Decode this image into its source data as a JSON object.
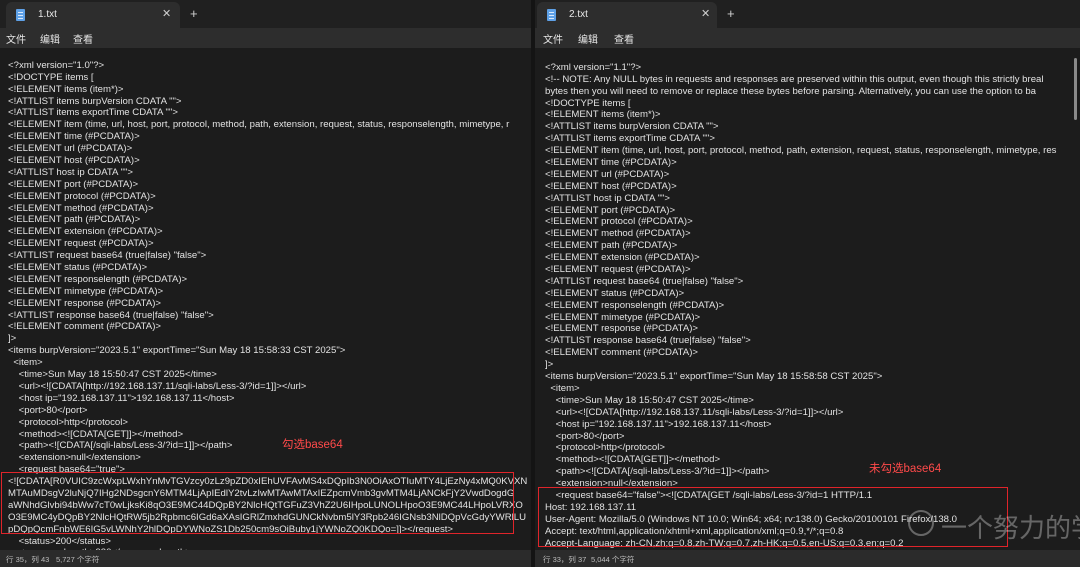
{
  "left": {
    "tab_title": "1.txt",
    "tab_close": "✕",
    "new_tab": "+",
    "menu": [
      "文件",
      "编辑",
      "查看"
    ],
    "lines": [
      "",
      "<?xml version=\"1.0\"?>",
      "<!DOCTYPE items [",
      "<!ELEMENT items (item*)>",
      "<!ATTLIST items burpVersion CDATA \"\">",
      "<!ATTLIST items exportTime CDATA \"\">",
      "<!ELEMENT item (time, url, host, port, protocol, method, path, extension, request, status, responselength, mimetype, r",
      "<!ELEMENT time (#PCDATA)>",
      "<!ELEMENT url (#PCDATA)>",
      "<!ELEMENT host (#PCDATA)>",
      "<!ATTLIST host ip CDATA \"\">",
      "<!ELEMENT port (#PCDATA)>",
      "<!ELEMENT protocol (#PCDATA)>",
      "<!ELEMENT method (#PCDATA)>",
      "<!ELEMENT path (#PCDATA)>",
      "<!ELEMENT extension (#PCDATA)>",
      "<!ELEMENT request (#PCDATA)>",
      "<!ATTLIST request base64 (true|false) \"false\">",
      "<!ELEMENT status (#PCDATA)>",
      "<!ELEMENT responselength (#PCDATA)>",
      "<!ELEMENT mimetype (#PCDATA)>",
      "<!ELEMENT response (#PCDATA)>",
      "<!ATTLIST response base64 (true|false) \"false\">",
      "<!ELEMENT comment (#PCDATA)>",
      "]>",
      "<items burpVersion=\"2023.5.1\" exportTime=\"Sun May 18 15:58:33 CST 2025\">",
      "  <item>",
      "    <time>Sun May 18 15:50:47 CST 2025</time>",
      "    <url><![CDATA[http://192.168.137.11/sqli-labs/Less-3/?id=1]]></url>",
      "    <host ip=\"192.168.137.11\">192.168.137.11</host>",
      "    <port>80</port>",
      "    <protocol>http</protocol>",
      "    <method><![CDATA[GET]]></method>",
      "    <path><![CDATA[/sqli-labs/Less-3/?id=1]]></path>",
      "    <extension>null</extension>",
      "    <request base64=\"true\">",
      "<![CDATA[R0VUIC9zcWxpLWxhYnMvTGVzcy0zLz9pZD0xIEhUVFAvMS4xDQpIb3N0OiAxOTIuMTY4LjEzNy4xMQ0KVXN",
      "MTAuMDsgV2luNjQ7IHg2NDsgcnY6MTM4LjApIEdlY2tvLzIwMTAwMTAxIEZpcmVmb3gvMTM4LjANCkFjY2VwdDogdG",
      "aWNhdGlvbi94bWw7cT0wLjksKi8qO3E9MC44DQpBY2NlcHQtTGFuZ3VhZ2U6IHpoLUNOLHpoO3E9MC44LHpoLVRXO",
      "O3E9MC4yDQpBY2NlcHQtRW5jb2Rpbmc6IGd6aXAsIGRlZmxhdGUNCkNvbm5lY3Rpb246IGNsb3NlDQpVcGdyYWRlLU",
      "pDQpQcmFnbWE6IG5vLWNhY2hlDQpDYWNoZS1Db250cm9sOiBuby1jYWNoZQ0KDQo=]]></request>",
      "    <status>200</status>",
      "    <responselength>930</responselength>"
    ],
    "annotation": "勾选base64",
    "status_pos": "行 35，列 43",
    "status_count": "5,727 个字符"
  },
  "right": {
    "tab_title": "2.txt",
    "tab_close": "✕",
    "new_tab": "+",
    "menu": [
      "文件",
      "编辑",
      "查看"
    ],
    "lines": [
      "",
      "<?xml version=\"1.1\"?>",
      "<!-- NOTE: Any NULL bytes in requests and responses are preserved within this output, even though this strictly breal",
      "bytes then you will need to remove or replace these bytes before parsing. Alternatively, you can use the option to ba",
      "<!DOCTYPE items [",
      "<!ELEMENT items (item*)>",
      "<!ATTLIST items burpVersion CDATA \"\">",
      "<!ATTLIST items exportTime CDATA \"\">",
      "<!ELEMENT item (time, url, host, port, protocol, method, path, extension, request, status, responselength, mimetype, res",
      "<!ELEMENT time (#PCDATA)>",
      "<!ELEMENT url (#PCDATA)>",
      "<!ELEMENT host (#PCDATA)>",
      "<!ATTLIST host ip CDATA \"\">",
      "<!ELEMENT port (#PCDATA)>",
      "<!ELEMENT protocol (#PCDATA)>",
      "<!ELEMENT method (#PCDATA)>",
      "<!ELEMENT path (#PCDATA)>",
      "<!ELEMENT extension (#PCDATA)>",
      "<!ELEMENT request (#PCDATA)>",
      "<!ATTLIST request base64 (true|false) \"false\">",
      "<!ELEMENT status (#PCDATA)>",
      "<!ELEMENT responselength (#PCDATA)>",
      "<!ELEMENT mimetype (#PCDATA)>",
      "<!ELEMENT response (#PCDATA)>",
      "<!ATTLIST response base64 (true|false) \"false\">",
      "<!ELEMENT comment (#PCDATA)>",
      "]>",
      "<items burpVersion=\"2023.5.1\" exportTime=\"Sun May 18 15:58:58 CST 2025\">",
      "  <item>",
      "    <time>Sun May 18 15:50:47 CST 2025</time>",
      "    <url><![CDATA[http://192.168.137.11/sqli-labs/Less-3/?id=1]]></url>",
      "    <host ip=\"192.168.137.11\">192.168.137.11</host>",
      "    <port>80</port>",
      "    <protocol>http</protocol>",
      "    <method><![CDATA[GET]]></method>",
      "    <path><![CDATA[/sqli-labs/Less-3/?id=1]]></path>",
      "    <extension>null</extension>",
      "    <request base64=\"false\"><![CDATA[GET /sqli-labs/Less-3/?id=1 HTTP/1.1",
      "Host: 192.168.137.11",
      "User-Agent: Mozilla/5.0 (Windows NT 10.0; Win64; x64; rv:138.0) Gecko/20100101 Firefox/138.0",
      "Accept: text/html,application/xhtml+xml,application/xml;q=0.9,*/*;q=0.8",
      "Accept-Language: zh-CN,zh;q=0.8,zh-TW;q=0.7,zh-HK;q=0.5,en-US;q=0.3,en;q=0.2",
      "Accept-Encoding: gzip, deflate"
    ],
    "annotation": "未勾选base64",
    "status_pos": "行 33，列 37",
    "status_count": "5,044 个字符"
  },
  "watermark": "一个努力的学渣"
}
